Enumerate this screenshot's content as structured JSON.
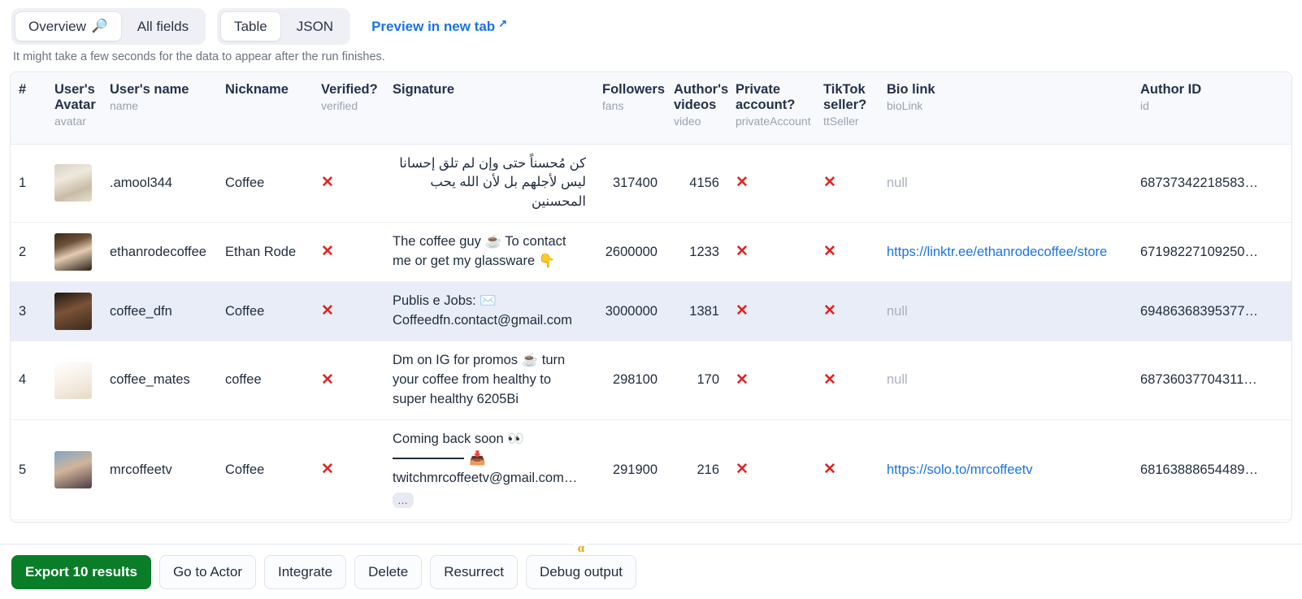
{
  "tabs": {
    "group1": [
      {
        "label": "Overview",
        "icon": "magnifier-icon",
        "glyph": "🔎",
        "active": true
      },
      {
        "label": "All fields",
        "active": false
      }
    ],
    "group2": [
      {
        "label": "Table",
        "active": true
      },
      {
        "label": "JSON",
        "active": false
      }
    ],
    "preview_link": "Preview in new tab",
    "preview_arrow": "↗"
  },
  "hint": "It might take a few seconds for the data to appear after the run finishes.",
  "table": {
    "columns": [
      {
        "title": "#",
        "sub": ""
      },
      {
        "title": "User's Avatar",
        "sub": "avatar"
      },
      {
        "title": "User's name",
        "sub": "name"
      },
      {
        "title": "Nickname",
        "sub": ""
      },
      {
        "title": "Verified?",
        "sub": "verified"
      },
      {
        "title": "Signature",
        "sub": ""
      },
      {
        "title": "Followers",
        "sub": "fans"
      },
      {
        "title": "Author's videos",
        "sub": "video"
      },
      {
        "title": "Private account?",
        "sub": "privateAccount"
      },
      {
        "title": "TikTok seller?",
        "sub": "ttSeller"
      },
      {
        "title": "Bio link",
        "sub": "bioLink"
      },
      {
        "title": "Author ID",
        "sub": "id"
      }
    ],
    "rows": [
      {
        "index": "1",
        "avatar_alt": "amool344-avatar",
        "name": ".amool344",
        "nickname": "Coffee",
        "verified": "✕",
        "signature": "كن مُحسناً حتى وإن لم تلق إحسانا ليس لأجلهم بل لأن الله يحب المحسنين",
        "signature_rtl": true,
        "fans": "317400",
        "video": "4156",
        "privateAccount": "✕",
        "ttSeller": "✕",
        "bioLink": "null",
        "bioLink_is_link": false,
        "id": "68737342218583…",
        "highlight": false
      },
      {
        "index": "2",
        "avatar_alt": "ethanrodecoffee-avatar",
        "name": "ethanrodecoffee",
        "nickname": "Ethan Rode",
        "verified": "✕",
        "signature": "The coffee guy ☕ To contact me or get my glassware 👇",
        "signature_rtl": false,
        "fans": "2600000",
        "video": "1233",
        "privateAccount": "✕",
        "ttSeller": "✕",
        "bioLink": "https://linktr.ee/ethanrodecoffee/store",
        "bioLink_is_link": true,
        "id": "67198227109250…",
        "highlight": false
      },
      {
        "index": "3",
        "avatar_alt": "coffee_dfn-avatar",
        "name": "coffee_dfn",
        "nickname": "Coffee",
        "verified": "✕",
        "signature": "Publis e Jobs: ✉️ Coffeedfn.contact@gmail.com",
        "signature_rtl": false,
        "fans": "3000000",
        "video": "1381",
        "privateAccount": "✕",
        "ttSeller": "✕",
        "bioLink": "null",
        "bioLink_is_link": false,
        "id": "69486368395377…",
        "highlight": true
      },
      {
        "index": "4",
        "avatar_alt": "coffee_mates-avatar",
        "name": "coffee_mates",
        "nickname": "coffee",
        "verified": "✕",
        "signature": "Dm on IG for promos ☕ turn your coffee from healthy to super healthy 6205Bi",
        "signature_rtl": false,
        "fans": "298100",
        "video": "170",
        "privateAccount": "✕",
        "ttSeller": "✕",
        "bioLink": "null",
        "bioLink_is_link": false,
        "id": "68736037704311…",
        "highlight": false
      },
      {
        "index": "5",
        "avatar_alt": "mrcoffeetv-avatar",
        "name": "mrcoffeetv",
        "nickname": "Coffee",
        "verified": "✕",
        "signature_line1": "Coming back soon 👀",
        "signature_line2_emoji": "📥",
        "signature_line3": "twitchmrcoffeetv@gmail.com…",
        "signature_expand": "…",
        "signature_rtl": false,
        "fans": "291900",
        "video": "216",
        "privateAccount": "✕",
        "ttSeller": "✕",
        "bioLink": "https://solo.to/mrcoffeetv",
        "bioLink_is_link": true,
        "id": "68163888654489…",
        "highlight": false
      }
    ]
  },
  "actions": {
    "export": "Export 10 results",
    "go_to_actor": "Go to Actor",
    "integrate": "Integrate",
    "delete": "Delete",
    "resurrect": "Resurrect",
    "debug_output": "Debug output",
    "debug_badge": "α"
  },
  "colors": {
    "primary_green": "#0a7d28",
    "link_blue": "#1a73e8",
    "x_red": "#e02424",
    "alpha_orange": "#f59e0b",
    "row_highlight": "#e9edf7"
  }
}
